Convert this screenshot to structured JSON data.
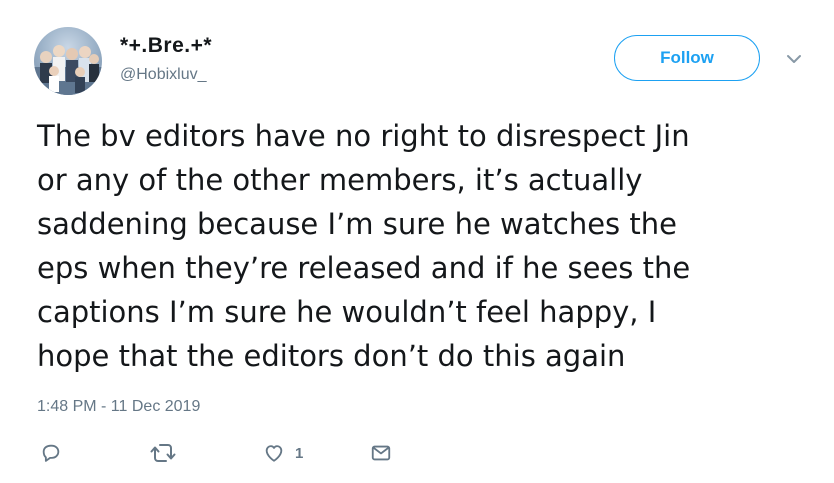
{
  "user": {
    "display_name": "*+.Bre.+*",
    "handle": "@Hobixluv_"
  },
  "follow_button": {
    "label": "Follow"
  },
  "tweet": {
    "text": "The bv editors have no right to disrespect Jin\nor any of the other members, it’s actually\nsaddening because I’m sure he watches the\neps when they’re released and if he sees the\ncaptions I’m sure he wouldn’t feel happy, I\nhope that the editors don’t do this again",
    "timestamp": "1:48 PM - 11 Dec 2019"
  },
  "actions": {
    "like_count": "1"
  },
  "icons": {
    "reply": "reply-icon",
    "retweet": "retweet-icon",
    "like": "heart-icon",
    "dm": "envelope-icon",
    "menu": "chevron-down-icon"
  },
  "colors": {
    "accent": "#1da1f2",
    "text": "#14171a",
    "muted": "#657786"
  }
}
